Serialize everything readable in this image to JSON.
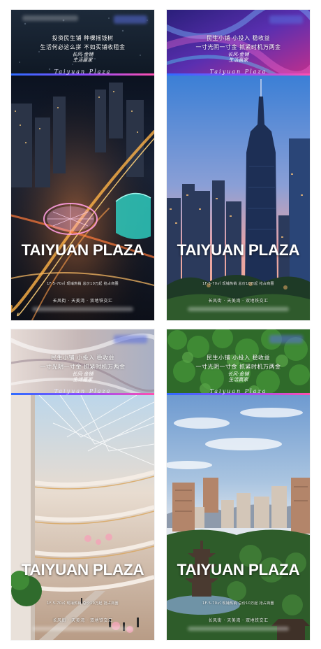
{
  "posters": [
    {
      "headline_lines": [
        "投资民生铺 种棵摇钱树",
        "生活何必这么拼 不如买铺收租金"
      ],
      "slogan_lines": [
        "长风·金铺",
        "生活赢家"
      ],
      "plaza_script": "Taiyuan Plaza",
      "title": "TAIYUAN PLAZA",
      "info_line": "1F·5-70㎡ 现铺热销 总价10万起 抢占商圈",
      "tag_line": "长风街 · 天美湾 · 双地铁交汇"
    },
    {
      "headline_lines": [
        "民生小铺 小投入 稳收益",
        "一寸光阴一寸金 抓紧时机万两金"
      ],
      "slogan_lines": [
        "长风·金铺",
        "生活赢家"
      ],
      "plaza_script": "Taiyuan Plaza",
      "title": "TAIYUAN PLAZA",
      "info_line": "1F·5-70㎡ 现铺热销 总价10万起 抢占商圈",
      "tag_line": "长风街 · 天美湾 · 双地铁交汇"
    },
    {
      "headline_lines": [
        "民生小铺 小投入 稳收益",
        "一寸光阴一寸金 抓紧时机万两金"
      ],
      "slogan_lines": [
        "长风·金铺",
        "生活赢家"
      ],
      "plaza_script": "Taiyuan Plaza",
      "title": "TAIYUAN PLAZA",
      "info_line": "1F·5-70㎡ 现铺热销 总价10万起 抢占商圈",
      "tag_line": "长风街 · 天美湾 · 双地铁交汇"
    },
    {
      "headline_lines": [
        "民生小铺 小投入 稳收益",
        "一寸光阴一寸金 抓紧时机万两金"
      ],
      "slogan_lines": [
        "长风·金铺",
        "生活赢家"
      ],
      "plaza_script": "Taiyuan Plaza",
      "title": "TAIYUAN PLAZA",
      "info_line": "1F·5-70㎡ 现铺热销 总价10万起 抢占商圈",
      "tag_line": "长风街 · 天美湾 · 双地铁交汇"
    }
  ],
  "colors": {
    "accent_gradient": [
      "#2f6bff",
      "#8a4dff",
      "#ff4fb0"
    ],
    "title_text": "#ffffff"
  },
  "scenes": [
    "night-city-interchange-photo",
    "skyscraper-sunset-photo",
    "shopping-mall-atrium-photo",
    "city-pagoda-park-photo"
  ]
}
